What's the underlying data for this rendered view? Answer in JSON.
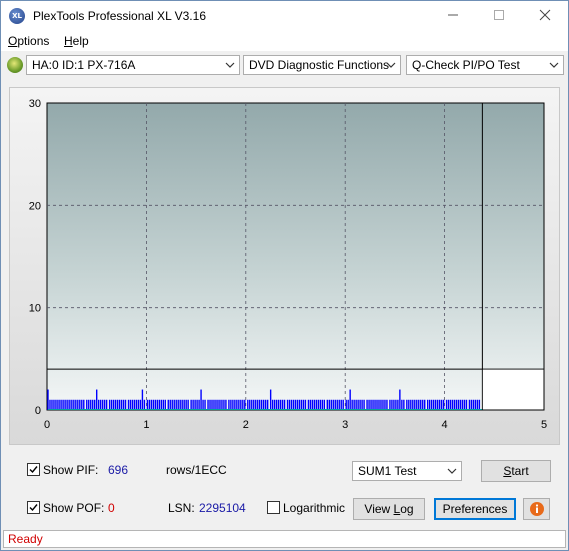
{
  "window": {
    "title": "PlexTools Professional XL V3.16",
    "icon_text": "XL"
  },
  "menu": [
    {
      "label": "Options",
      "accel": "O"
    },
    {
      "label": "Help",
      "accel": "H"
    }
  ],
  "toolbar": {
    "drive_select": "HA:0 ID:1  PX-716A",
    "function_select": "DVD Diagnostic Functions",
    "test_select": "Q-Check PI/PO Test"
  },
  "chart_data": {
    "type": "bar",
    "y_ticks": [
      "0",
      "10",
      "20",
      "30"
    ],
    "x_ticks": [
      "0",
      "1",
      "2",
      "3",
      "4",
      "5"
    ],
    "xlim": [
      0,
      5
    ],
    "ylim": [
      0,
      30
    ],
    "grid": true,
    "marker_x": 4.38,
    "threshold_y": 4,
    "series_color": "#0000ff",
    "bars": [
      [
        0.01,
        2
      ],
      [
        0.03,
        1
      ],
      [
        0.05,
        1
      ],
      [
        0.07,
        1
      ],
      [
        0.09,
        1
      ],
      [
        0.11,
        1
      ],
      [
        0.13,
        1
      ],
      [
        0.15,
        1
      ],
      [
        0.17,
        1
      ],
      [
        0.19,
        1
      ],
      [
        0.21,
        1
      ],
      [
        0.23,
        1
      ],
      [
        0.25,
        1
      ],
      [
        0.27,
        1
      ],
      [
        0.29,
        1
      ],
      [
        0.31,
        1
      ],
      [
        0.33,
        1
      ],
      [
        0.35,
        1
      ],
      [
        0.37,
        1
      ],
      [
        0.4,
        1
      ],
      [
        0.42,
        1
      ],
      [
        0.44,
        1
      ],
      [
        0.46,
        1
      ],
      [
        0.48,
        1
      ],
      [
        0.5,
        2
      ],
      [
        0.52,
        1
      ],
      [
        0.54,
        1
      ],
      [
        0.56,
        1
      ],
      [
        0.58,
        1
      ],
      [
        0.6,
        1
      ],
      [
        0.63,
        1
      ],
      [
        0.65,
        1
      ],
      [
        0.67,
        1
      ],
      [
        0.69,
        1
      ],
      [
        0.71,
        1
      ],
      [
        0.73,
        1
      ],
      [
        0.75,
        1
      ],
      [
        0.77,
        1
      ],
      [
        0.79,
        1
      ],
      [
        0.82,
        1
      ],
      [
        0.84,
        1
      ],
      [
        0.86,
        1
      ],
      [
        0.88,
        1
      ],
      [
        0.9,
        1
      ],
      [
        0.92,
        1
      ],
      [
        0.94,
        1
      ],
      [
        0.96,
        2
      ],
      [
        0.98,
        1
      ],
      [
        1.01,
        1
      ],
      [
        1.03,
        1
      ],
      [
        1.05,
        1
      ],
      [
        1.07,
        1
      ],
      [
        1.09,
        1
      ],
      [
        1.11,
        1
      ],
      [
        1.13,
        1
      ],
      [
        1.15,
        1
      ],
      [
        1.17,
        1
      ],
      [
        1.19,
        1
      ],
      [
        1.22,
        1
      ],
      [
        1.24,
        1
      ],
      [
        1.26,
        1
      ],
      [
        1.28,
        1
      ],
      [
        1.3,
        1
      ],
      [
        1.32,
        1
      ],
      [
        1.34,
        1
      ],
      [
        1.36,
        1
      ],
      [
        1.38,
        1
      ],
      [
        1.4,
        1
      ],
      [
        1.42,
        1
      ],
      [
        1.45,
        1
      ],
      [
        1.47,
        1
      ],
      [
        1.49,
        1
      ],
      [
        1.51,
        1
      ],
      [
        1.53,
        1
      ],
      [
        1.55,
        2
      ],
      [
        1.57,
        1
      ],
      [
        1.59,
        1
      ],
      [
        1.62,
        1
      ],
      [
        1.64,
        1
      ],
      [
        1.66,
        1
      ],
      [
        1.68,
        1
      ],
      [
        1.7,
        1
      ],
      [
        1.72,
        1
      ],
      [
        1.74,
        1
      ],
      [
        1.76,
        1
      ],
      [
        1.78,
        1
      ],
      [
        1.8,
        1
      ],
      [
        1.83,
        1
      ],
      [
        1.85,
        1
      ],
      [
        1.87,
        1
      ],
      [
        1.89,
        1
      ],
      [
        1.91,
        1
      ],
      [
        1.93,
        1
      ],
      [
        1.95,
        1
      ],
      [
        1.97,
        1
      ],
      [
        1.99,
        1
      ],
      [
        2.02,
        1
      ],
      [
        2.04,
        1
      ],
      [
        2.06,
        1
      ],
      [
        2.08,
        1
      ],
      [
        2.1,
        1
      ],
      [
        2.12,
        1
      ],
      [
        2.14,
        1
      ],
      [
        2.16,
        1
      ],
      [
        2.18,
        1
      ],
      [
        2.2,
        1
      ],
      [
        2.22,
        1
      ],
      [
        2.25,
        2
      ],
      [
        2.27,
        1
      ],
      [
        2.29,
        1
      ],
      [
        2.31,
        1
      ],
      [
        2.33,
        1
      ],
      [
        2.35,
        1
      ],
      [
        2.37,
        1
      ],
      [
        2.39,
        1
      ],
      [
        2.42,
        1
      ],
      [
        2.44,
        1
      ],
      [
        2.46,
        1
      ],
      [
        2.48,
        1
      ],
      [
        2.5,
        1
      ],
      [
        2.52,
        1
      ],
      [
        2.54,
        1
      ],
      [
        2.56,
        1
      ],
      [
        2.58,
        1
      ],
      [
        2.6,
        1
      ],
      [
        2.63,
        1
      ],
      [
        2.65,
        1
      ],
      [
        2.67,
        1
      ],
      [
        2.69,
        1
      ],
      [
        2.71,
        1
      ],
      [
        2.73,
        1
      ],
      [
        2.75,
        1
      ],
      [
        2.77,
        1
      ],
      [
        2.79,
        1
      ],
      [
        2.82,
        1
      ],
      [
        2.84,
        1
      ],
      [
        2.86,
        1
      ],
      [
        2.88,
        1
      ],
      [
        2.9,
        1
      ],
      [
        2.92,
        1
      ],
      [
        2.94,
        1
      ],
      [
        2.96,
        1
      ],
      [
        2.98,
        1
      ],
      [
        3.01,
        1
      ],
      [
        3.03,
        1
      ],
      [
        3.05,
        2
      ],
      [
        3.07,
        1
      ],
      [
        3.09,
        1
      ],
      [
        3.11,
        1
      ],
      [
        3.13,
        1
      ],
      [
        3.15,
        1
      ],
      [
        3.17,
        1
      ],
      [
        3.19,
        1
      ],
      [
        3.22,
        1
      ],
      [
        3.24,
        1
      ],
      [
        3.26,
        1
      ],
      [
        3.28,
        1
      ],
      [
        3.3,
        1
      ],
      [
        3.32,
        1
      ],
      [
        3.34,
        1
      ],
      [
        3.36,
        1
      ],
      [
        3.38,
        1
      ],
      [
        3.4,
        1
      ],
      [
        3.42,
        1
      ],
      [
        3.45,
        1
      ],
      [
        3.47,
        1
      ],
      [
        3.49,
        1
      ],
      [
        3.51,
        1
      ],
      [
        3.53,
        1
      ],
      [
        3.55,
        2
      ],
      [
        3.57,
        1
      ],
      [
        3.59,
        1
      ],
      [
        3.62,
        1
      ],
      [
        3.64,
        1
      ],
      [
        3.66,
        1
      ],
      [
        3.68,
        1
      ],
      [
        3.7,
        1
      ],
      [
        3.72,
        1
      ],
      [
        3.74,
        1
      ],
      [
        3.76,
        1
      ],
      [
        3.78,
        1
      ],
      [
        3.8,
        1
      ],
      [
        3.83,
        1
      ],
      [
        3.85,
        1
      ],
      [
        3.87,
        1
      ],
      [
        3.89,
        1
      ],
      [
        3.91,
        1
      ],
      [
        3.93,
        1
      ],
      [
        3.95,
        1
      ],
      [
        3.97,
        1
      ],
      [
        3.99,
        1
      ],
      [
        4.02,
        1
      ],
      [
        4.04,
        1
      ],
      [
        4.06,
        1
      ],
      [
        4.08,
        1
      ],
      [
        4.1,
        1
      ],
      [
        4.12,
        1
      ],
      [
        4.14,
        1
      ],
      [
        4.16,
        1
      ],
      [
        4.18,
        1
      ],
      [
        4.2,
        1
      ],
      [
        4.22,
        1
      ],
      [
        4.25,
        1
      ],
      [
        4.27,
        1
      ],
      [
        4.29,
        1
      ],
      [
        4.31,
        1
      ],
      [
        4.33,
        1
      ],
      [
        4.35,
        1
      ]
    ]
  },
  "controls": {
    "show_pif_label": "Show PIF:",
    "show_pif_checked": true,
    "pif_value": "696",
    "rows_label": "rows/1ECC",
    "show_pof_label": "Show POF:",
    "show_pof_checked": true,
    "pof_value": "0",
    "lsn_label": "LSN:",
    "lsn_value": "2295104",
    "logarithmic_label": "Logarithmic",
    "logarithmic_checked": false,
    "sum_select": "SUM1 Test",
    "start_button": "Start",
    "view_log_button": "View Log",
    "preferences_button": "Preferences"
  },
  "status": {
    "text": "Ready",
    "color": "#d00000"
  }
}
